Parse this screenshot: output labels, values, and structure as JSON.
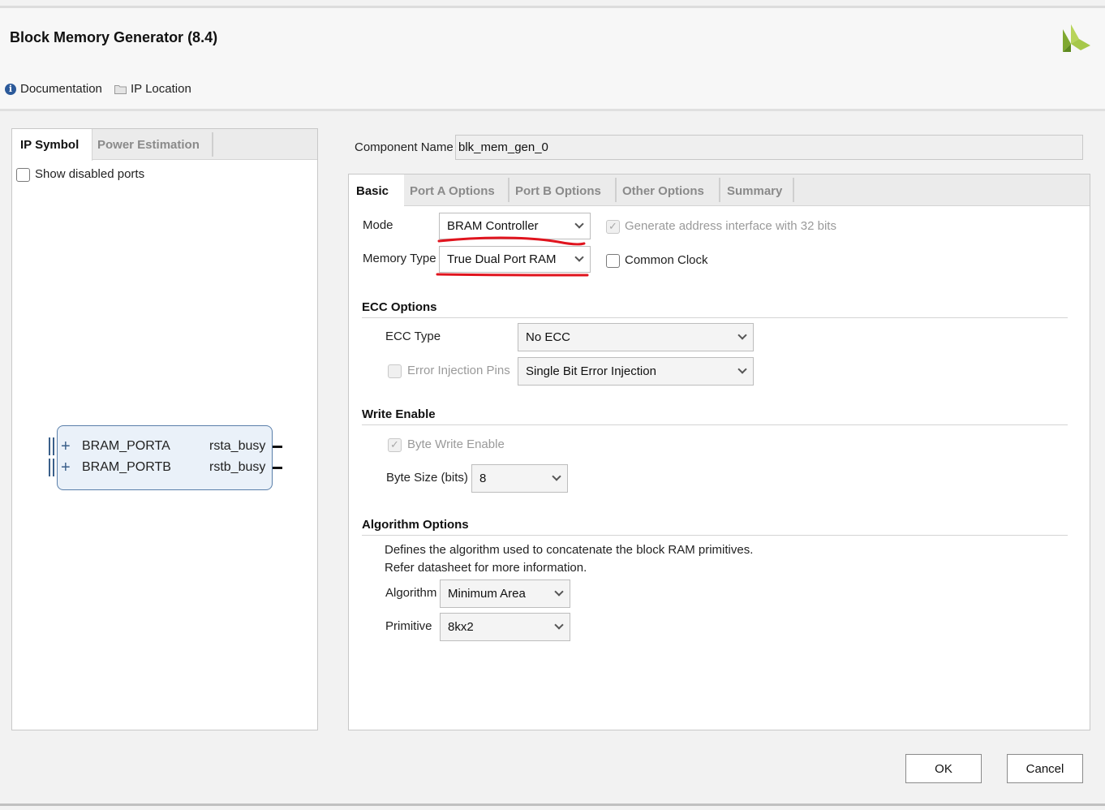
{
  "window": {
    "title": "Block Memory Generator (8.4)"
  },
  "header_links": {
    "documentation": "Documentation",
    "ip_location": "IP Location"
  },
  "left_panel": {
    "tabs": [
      "IP Symbol",
      "Power Estimation"
    ],
    "active_tab": "IP Symbol",
    "show_disabled_ports": {
      "label": "Show disabled ports",
      "checked": false
    },
    "symbol": {
      "ports_left": [
        "BRAM_PORTA",
        "BRAM_PORTB"
      ],
      "ports_right": [
        "rsta_busy",
        "rstb_busy"
      ]
    }
  },
  "component_name": {
    "label": "Component Name",
    "value": "blk_mem_gen_0"
  },
  "right_tabs": [
    "Basic",
    "Port A Options",
    "Port B Options",
    "Other Options",
    "Summary"
  ],
  "active_right_tab": "Basic",
  "basic": {
    "mode": {
      "label": "Mode",
      "value": "BRAM Controller"
    },
    "memory_type": {
      "label": "Memory Type",
      "value": "True Dual Port RAM"
    },
    "generate_addr": {
      "label": "Generate address interface with 32 bits",
      "checked": true,
      "disabled": true
    },
    "common_clock": {
      "label": "Common Clock",
      "checked": false
    }
  },
  "ecc": {
    "title": "ECC Options",
    "ecc_type": {
      "label": "ECC Type",
      "value": "No ECC"
    },
    "error_injection": {
      "label": "Error Injection Pins",
      "value": "Single Bit Error Injection",
      "checked": false,
      "disabled": true
    }
  },
  "write_enable": {
    "title": "Write Enable",
    "byte_write_enable": {
      "label": "Byte Write Enable",
      "checked": true,
      "disabled": true
    },
    "byte_size": {
      "label": "Byte Size (bits)",
      "value": "8"
    }
  },
  "algorithm": {
    "title": "Algorithm Options",
    "desc_line1": "Defines the algorithm used to concatenate the block RAM primitives.",
    "desc_line2": "Refer datasheet for more information.",
    "algorithm": {
      "label": "Algorithm",
      "value": "Minimum Area"
    },
    "primitive": {
      "label": "Primitive",
      "value": "8kx2"
    }
  },
  "buttons": {
    "ok": "OK",
    "cancel": "Cancel"
  },
  "colors": {
    "annotation_red": "#e0141e",
    "logo_green": "#9bc53d",
    "symbol_border": "#5a7faa"
  },
  "icons": [
    "info-icon",
    "folder-icon",
    "xilinx-logo-icon",
    "chevron-down-icon",
    "plus-icon",
    "bus-icon"
  ]
}
